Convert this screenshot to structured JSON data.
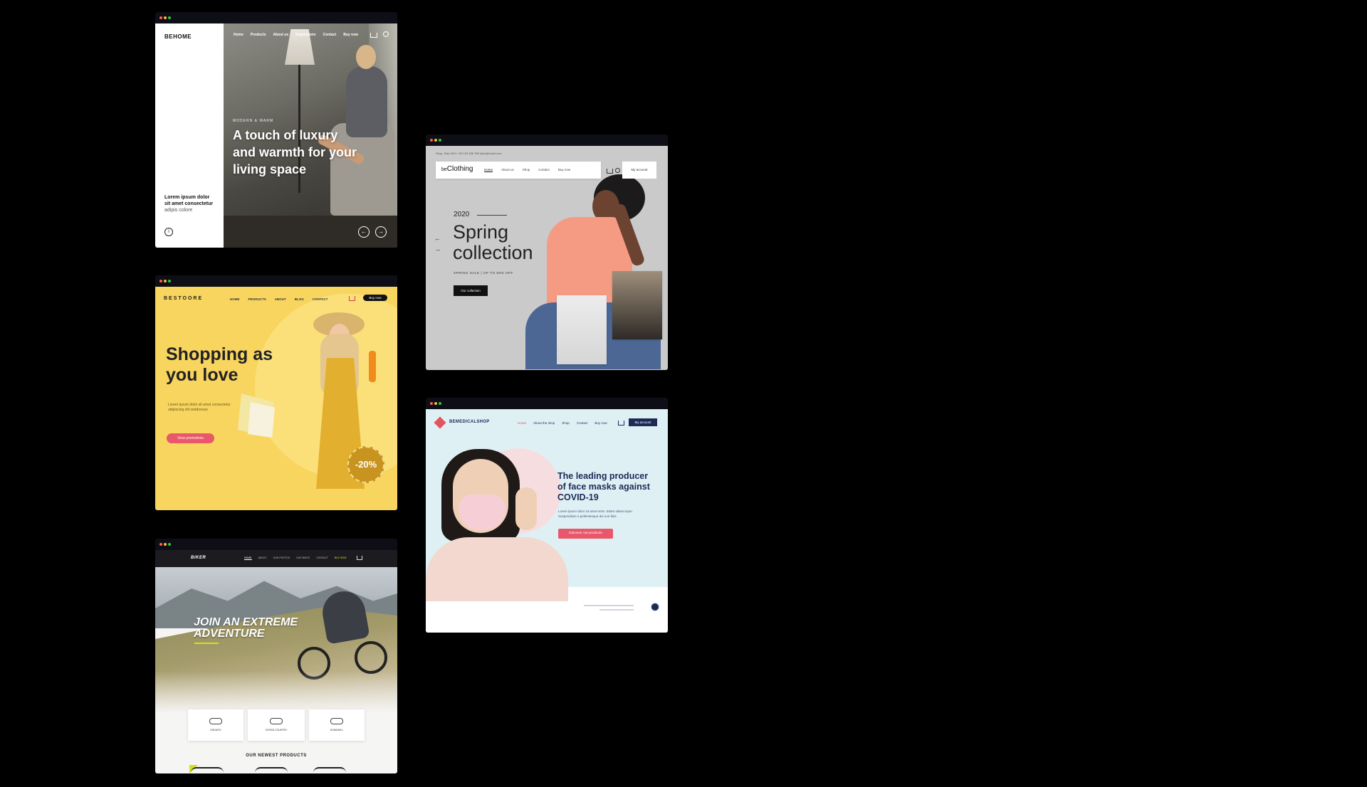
{
  "behome": {
    "logo": "BEHOME",
    "nav": [
      "Home",
      "Products",
      "About us",
      "Inspirations",
      "Contact",
      "Buy now"
    ],
    "tagline": "MODERN & WARM",
    "headline": [
      "A touch of luxury",
      "and warmth for your",
      "living space"
    ],
    "side_text": [
      "Lorem ipsum dolor",
      "sit amet consectetur",
      "adipis colore"
    ]
  },
  "beclothing": {
    "topbar": "Shop: Sale 2021   +00 123 456 789   hello@email.com",
    "logo_prefix": "be",
    "logo": "Clothing",
    "nav": [
      "Home",
      "About us",
      "Shop",
      "Contact",
      "Buy now"
    ],
    "account": "My account",
    "year": "2020",
    "headline": [
      "Spring",
      "collection"
    ],
    "sub": "SPRING SALE | UP TO 50% OFF",
    "button": "Our collection",
    "arrow_prev": "←",
    "arrow_next": "→"
  },
  "bestore": {
    "logo": "BESTOORE",
    "nav": [
      "HOME",
      "PRODUCTS",
      "ABOUT",
      "BLOG",
      "CONTACT"
    ],
    "button_nav": "Buy now",
    "headline": [
      "Shopping as",
      "you love"
    ],
    "sub": [
      "Lorem ipsum dolor sit amet consectetur",
      "adipiscing elit seddonose"
    ],
    "button": "View promotions",
    "badge": "-20%"
  },
  "bemedical": {
    "logo": "BEMEDICALSHOP",
    "nav": [
      "Home",
      "About the shop",
      "Shop",
      "Contact",
      "Buy now"
    ],
    "account": "My account",
    "headline": [
      "The leading producer",
      "of face masks against",
      "COVID-19"
    ],
    "sub": [
      "Lorem ipsum dolor sit amet enim. Etiam ullamcorper.",
      "Suspendisse a pellentesque dui non felis."
    ],
    "button": "Discover our products"
  },
  "biker": {
    "logo": "BIKER",
    "nav": [
      "HOME",
      "ABOUT",
      "OUR PHOTOS",
      "OUR BIKES",
      "CONTACT",
      "BUY NOW"
    ],
    "headline": [
      "JOIN AN EXTREME",
      "ADVENTURE"
    ],
    "categories": [
      "ENDURO",
      "CROSS COUNTRY",
      "DOWNHILL"
    ],
    "section_title": "OUR NEWEST PRODUCTS"
  }
}
